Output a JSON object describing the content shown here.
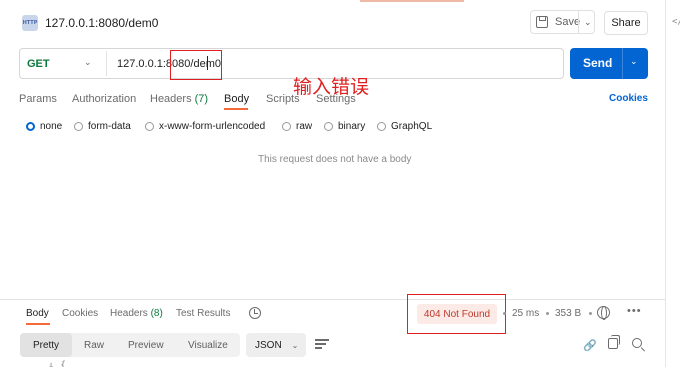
{
  "request": {
    "icon_text": "HTTP",
    "title": "127.0.0.1:8080/dem0",
    "method": "GET",
    "url": "127.0.0.1:8080/dem0"
  },
  "toolbar": {
    "save_label": "Save",
    "share_label": "Share",
    "send_label": "Send"
  },
  "annotation": {
    "text": "输入错误",
    "color": "#e02020"
  },
  "request_tabs": [
    {
      "label": "Params"
    },
    {
      "label": "Authorization"
    },
    {
      "label": "Headers",
      "count": "(7)"
    },
    {
      "label": "Body",
      "active": true
    },
    {
      "label": "Scripts"
    },
    {
      "label": "Settings"
    }
  ],
  "cookies_label": "Cookies",
  "body_types": [
    {
      "label": "none",
      "selected": true
    },
    {
      "label": "form-data"
    },
    {
      "label": "x-www-form-urlencoded"
    },
    {
      "label": "raw"
    },
    {
      "label": "binary"
    },
    {
      "label": "GraphQL"
    }
  ],
  "empty_body_message": "This request does not have a body",
  "response": {
    "tabs": [
      {
        "label": "Body",
        "active": true
      },
      {
        "label": "Cookies"
      },
      {
        "label": "Headers",
        "count": "(8)"
      },
      {
        "label": "Test Results"
      }
    ],
    "status": "404 Not Found",
    "time": "25 ms",
    "size": "353 B",
    "view_modes": [
      "Pretty",
      "Raw",
      "Preview",
      "Visualize"
    ],
    "active_view": "Pretty",
    "format": "JSON",
    "code_preview": "↓  {"
  },
  "colors": {
    "accent": "#f26b3a",
    "send": "#0265d2",
    "method": "#0b7a3b",
    "error": "#c0392b"
  }
}
